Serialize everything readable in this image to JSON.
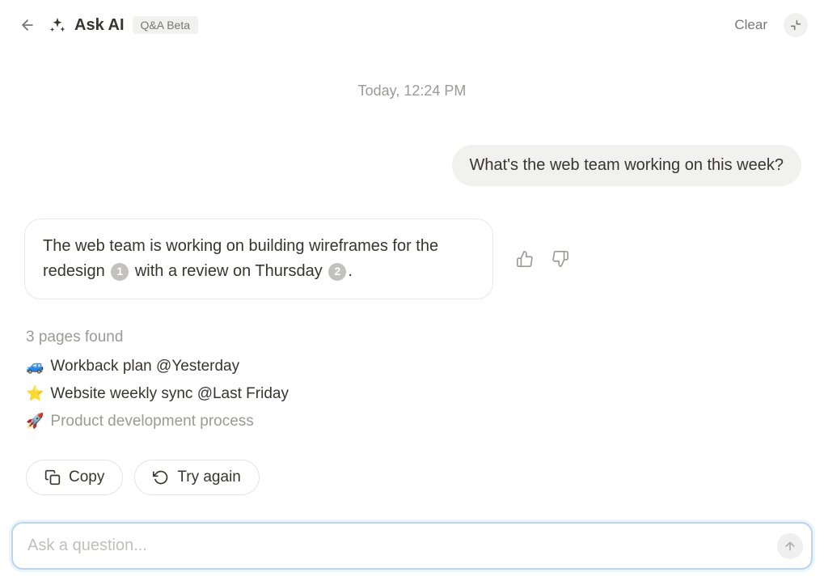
{
  "header": {
    "title": "Ask AI",
    "badge": "Q&A Beta",
    "clear_label": "Clear"
  },
  "chat": {
    "timestamp": "Today, 12:24 PM",
    "user_message": "What's the web team working on this week?",
    "ai_response_text_1": "The web team is working on building wireframes for the redesign ",
    "ai_response_text_2": " with a review on Thursday ",
    "ai_response_text_3": ".",
    "citation_1": "1",
    "citation_2": "2"
  },
  "sources": {
    "heading": "3 pages found",
    "items": [
      {
        "emoji": "🚙",
        "title": "Workback plan ",
        "meta": "@Yesterday",
        "muted": false
      },
      {
        "emoji": "⭐",
        "title": "Website weekly sync ",
        "meta": "@Last Friday",
        "muted": false
      },
      {
        "emoji": "🚀",
        "title": "Product development process",
        "meta": "",
        "muted": true
      }
    ]
  },
  "actions": {
    "copy_label": "Copy",
    "retry_label": "Try again"
  },
  "input": {
    "placeholder": "Ask a question..."
  }
}
